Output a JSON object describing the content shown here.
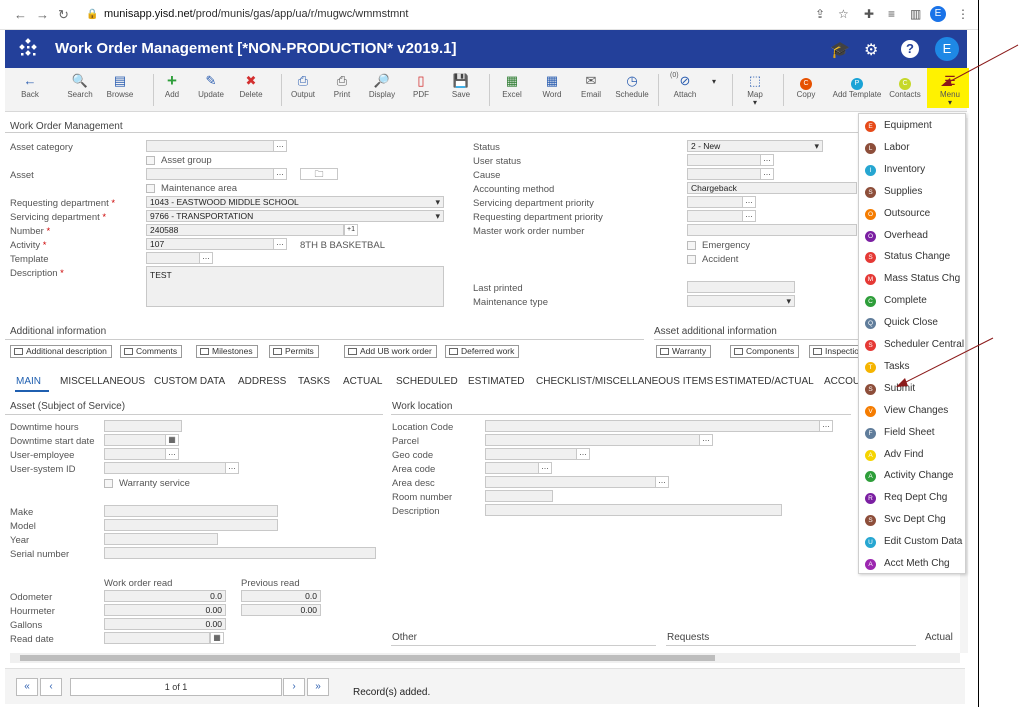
{
  "browser": {
    "url_domain": "munisapp.yisd.net",
    "url_path": "/prod/munis/gas/app/ua/r/mugwc/wmmstmnt",
    "profile_initial": "E"
  },
  "app": {
    "title": "Work Order Management [*NON-PRODUCTION* v2019.1]",
    "user_initial": "E"
  },
  "toolbar": [
    {
      "id": "back",
      "label": "Back",
      "icon": "←",
      "color": "#2a5db0"
    },
    {
      "id": "search",
      "label": "Search",
      "icon": "🔍",
      "color": "#444"
    },
    {
      "id": "browse",
      "label": "Browse",
      "icon": "▤",
      "color": "#2a5db0"
    },
    {
      "id": "add",
      "label": "Add",
      "icon": "+",
      "color": "#2e9e3a"
    },
    {
      "id": "update",
      "label": "Update",
      "icon": "✎",
      "color": "#2a5db0"
    },
    {
      "id": "delete",
      "label": "Delete",
      "icon": "✖",
      "color": "#d32f2f"
    },
    {
      "id": "output",
      "label": "Output",
      "icon": "⎙",
      "color": "#2a5db0"
    },
    {
      "id": "print",
      "label": "Print",
      "icon": "⎙",
      "color": "#555"
    },
    {
      "id": "display",
      "label": "Display",
      "icon": "🔎",
      "color": "#2a5db0"
    },
    {
      "id": "pdf",
      "label": "PDF",
      "icon": "▯",
      "color": "#d32f2f"
    },
    {
      "id": "save",
      "label": "Save",
      "icon": "💾",
      "color": "#7b3fa0"
    },
    {
      "id": "excel",
      "label": "Excel",
      "icon": "▦",
      "color": "#2e7d32"
    },
    {
      "id": "word",
      "label": "Word",
      "icon": "▦",
      "color": "#2a5db0"
    },
    {
      "id": "email",
      "label": "Email",
      "icon": "✉",
      "color": "#555"
    },
    {
      "id": "schedule",
      "label": "Schedule",
      "icon": "◷",
      "color": "#2a5db0"
    },
    {
      "id": "attach",
      "label": "Attach",
      "icon": "⊘",
      "color": "#2a5db0",
      "count": "(0)"
    },
    {
      "id": "map",
      "label": "Map",
      "icon": "⬚",
      "color": "#2a5db0"
    },
    {
      "id": "copy",
      "label": "Copy",
      "icon": "C",
      "color": "#e65100",
      "circle": true
    },
    {
      "id": "add-template",
      "label": "Add Template",
      "icon": "P",
      "color": "#1aa3d6",
      "circle": true
    },
    {
      "id": "contacts",
      "label": "Contacts",
      "icon": "C",
      "color": "#c6d82a",
      "circle": true
    },
    {
      "id": "menu",
      "label": "Menu",
      "icon": "☰",
      "color": "#555"
    }
  ],
  "form": {
    "header": "Work Order Management",
    "left": {
      "asset_category": "Asset category",
      "asset_group": "Asset group",
      "asset": "Asset",
      "maintenance_area": "Maintenance area",
      "requesting_department": "Requesting department",
      "requesting_department_value": "1043 - EASTWOOD MIDDLE SCHOOL",
      "servicing_department": "Servicing department",
      "servicing_department_value": "9766 - TRANSPORTATION",
      "number": "Number",
      "number_value": "240588",
      "number_btn": "+1",
      "activity": "Activity",
      "activity_value": "107",
      "activity_desc": "8TH B BASKETBAL",
      "template": "Template",
      "description": "Description",
      "description_value": "TEST",
      "required": "*"
    },
    "right": {
      "status": "Status",
      "status_value": "2 - New",
      "user_status": "User status",
      "cause": "Cause",
      "accounting_method": "Accounting method",
      "accounting_method_value": "Chargeback",
      "servicing_department_priority": "Servicing department priority",
      "requesting_department_priority": "Requesting department priority",
      "master_work_order_number": "Master work order number",
      "emergency": "Emergency",
      "accident": "Accident",
      "last_printed": "Last printed",
      "maintenance_type": "Maintenance type"
    },
    "additional_information": "Additional information",
    "asset_additional_information": "Asset additional information",
    "subsections": [
      "Additional description",
      "Comments",
      "Milestones",
      "Permits",
      "Add UB work order",
      "Deferred work"
    ],
    "asset_subsections": [
      "Warranty",
      "Components",
      "Inspectio"
    ],
    "tabs": [
      "MAIN",
      "MISCELLANEOUS",
      "CUSTOM DATA",
      "ADDRESS",
      "TASKS",
      "ACTUAL",
      "SCHEDULED",
      "ESTIMATED",
      "CHECKLIST/MISCELLANEOUS ITEMS",
      "ESTIMATED/ACTUAL",
      "ACCOU"
    ],
    "asset_section": {
      "title": "Asset (Subject of Service)",
      "downtime_hours": "Downtime hours",
      "downtime_start_date": "Downtime start date",
      "user_employee": "User-employee",
      "user_system_id": "User-system ID",
      "warranty_service": "Warranty service",
      "make": "Make",
      "model": "Model",
      "year": "Year",
      "serial_number": "Serial number"
    },
    "reads": {
      "work_order_read": "Work order read",
      "previous_read": "Previous read",
      "odometer": "Odometer",
      "odometer_value": "0.0",
      "odometer_prev": "0.0",
      "hourmeter": "Hourmeter",
      "hourmeter_value": "0.00",
      "hourmeter_prev": "0.00",
      "gallons": "Gallons",
      "gallons_value": "0.00",
      "read_date": "Read date"
    },
    "work_location": {
      "title": "Work location",
      "location_code": "Location Code",
      "parcel": "Parcel",
      "geo_code": "Geo code",
      "area_code": "Area code",
      "area_desc": "Area desc",
      "room_number": "Room number",
      "description": "Description"
    },
    "bottom": {
      "other": "Other",
      "requests": "Requests",
      "actual": "Actual"
    }
  },
  "footer": {
    "page": "1 of 1",
    "status": "Record(s) added."
  },
  "menu_items": [
    {
      "letter": "E",
      "label": "Equipment",
      "color": "#e64a19"
    },
    {
      "letter": "L",
      "label": "Labor",
      "color": "#8d4e3a"
    },
    {
      "letter": "I",
      "label": "Inventory",
      "color": "#26a6d1"
    },
    {
      "letter": "S",
      "label": "Supplies",
      "color": "#8d4e3a"
    },
    {
      "letter": "O",
      "label": "Outsource",
      "color": "#f57c00"
    },
    {
      "letter": "O",
      "label": "Overhead",
      "color": "#7b1fa2"
    },
    {
      "letter": "S",
      "label": "Status Change",
      "color": "#e53935"
    },
    {
      "letter": "M",
      "label": "Mass Status Chg",
      "color": "#e53935"
    },
    {
      "letter": "C",
      "label": "Complete",
      "color": "#2e9e3a"
    },
    {
      "letter": "Q",
      "label": "Quick Close",
      "color": "#607d9b"
    },
    {
      "letter": "S",
      "label": "Scheduler Central",
      "color": "#e53935"
    },
    {
      "letter": "T",
      "label": "Tasks",
      "color": "#f5b400"
    },
    {
      "letter": "S",
      "label": "Submit",
      "color": "#8d4e3a"
    },
    {
      "letter": "V",
      "label": "View Changes",
      "color": "#f57c00"
    },
    {
      "letter": "F",
      "label": "Field Sheet",
      "color": "#607d9b"
    },
    {
      "letter": "A",
      "label": "Adv Find",
      "color": "#f5d400"
    },
    {
      "letter": "A",
      "label": "Activity Change",
      "color": "#2e9e3a"
    },
    {
      "letter": "R",
      "label": "Req Dept Chg",
      "color": "#7b1fa2"
    },
    {
      "letter": "S",
      "label": "Svc Dept Chg",
      "color": "#8d4e3a"
    },
    {
      "letter": "U",
      "label": "Edit Custom Data",
      "color": "#26a6d1"
    },
    {
      "letter": "A",
      "label": "Acct Meth Chg",
      "color": "#9c27b0"
    }
  ]
}
